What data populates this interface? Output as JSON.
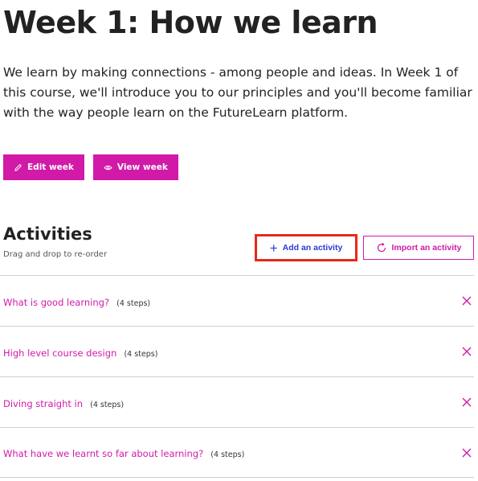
{
  "page": {
    "title": "Week 1: How we learn",
    "intro": "We learn by making connections - among people and ideas. In Week 1 of this course, we'll introduce you to our principles and you'll become familiar with the way people learn on the FutureLearn platform."
  },
  "buttons": {
    "edit_week": "Edit week",
    "view_week": "View week"
  },
  "activities": {
    "heading": "Activities",
    "subtext": "Drag and drop to re-order",
    "add_label": "Add an activity",
    "import_label": "Import an activity",
    "items": [
      {
        "title": "What is good learning?",
        "steps": "(4 steps)"
      },
      {
        "title": "High level course design",
        "steps": "(4 steps)"
      },
      {
        "title": "Diving straight in",
        "steps": "(4 steps)"
      },
      {
        "title": "What have we learnt so far about learning?",
        "steps": "(4 steps)"
      }
    ]
  },
  "icons": {
    "edit": "pencil-icon",
    "view": "eye-icon",
    "add": "plus-icon",
    "import": "refresh-icon",
    "remove": "close-icon"
  },
  "colors": {
    "brand": "#d11aa8",
    "add_text": "#2a3bd4",
    "highlight_border": "#e8281a"
  }
}
